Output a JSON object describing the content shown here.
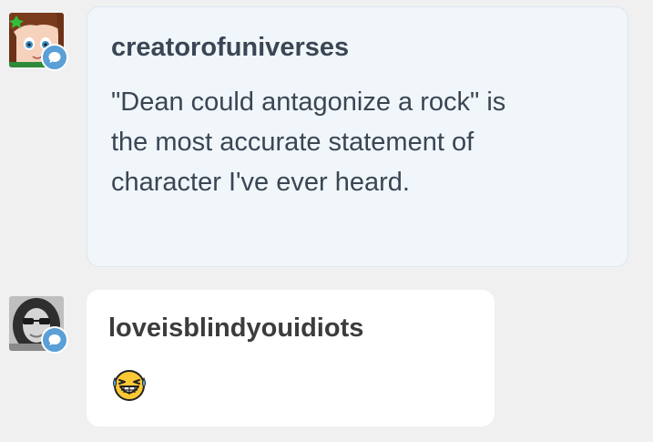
{
  "messages": [
    {
      "username": "creatorofuniverses",
      "text": "\"Dean could antagonize a rock\" is the most accurate statement of character I've ever heard.",
      "avatar_icon": "anime-girl-avatar",
      "badge_icon": "chat-bubble-icon"
    },
    {
      "username": "loveisblindyouidiots",
      "emoji": "grinning-squinting-face-with-tears-emoji",
      "avatar_icon": "woman-with-glasses-photo-avatar",
      "badge_icon": "chat-bubble-icon"
    }
  ],
  "colors": {
    "background": "#f0f0f0",
    "bubble_1": "#f1f6fa",
    "bubble_2": "#ffffff",
    "badge": "#5a9fd6",
    "text": "#3a4654"
  }
}
